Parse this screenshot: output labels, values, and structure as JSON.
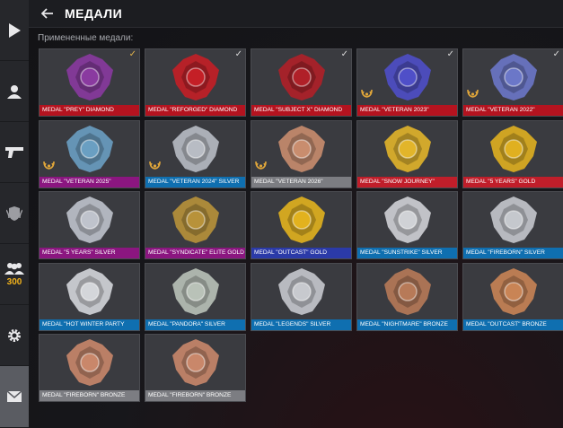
{
  "header": {
    "title": "МЕДАЛИ"
  },
  "subtitle": "Примененные медали:",
  "sidebar": {
    "friends_count": "300"
  },
  "colors": {
    "diamond": "#b4131f",
    "silver_blue": "#0f6fb0",
    "gold": "#c01e2a",
    "purple": "#8b1680",
    "grey": "#7c7d82",
    "gold_blue": "#2b3aa8"
  },
  "medals": [
    {
      "label": "MEDAL \"PREY\" DIAMOND",
      "color": "#b4131f",
      "check": "gold",
      "laurel": false,
      "icon": "prey-medal-icon",
      "art": "#8a3aa0"
    },
    {
      "label": "MEDAL \"REFORGED\" DIAMOND",
      "color": "#b4131f",
      "check": "white",
      "laurel": false,
      "icon": "reforged-medal-icon",
      "art": "#c41f26"
    },
    {
      "label": "MEDAL \"SUBJECT X\" DIAMOND",
      "color": "#b4131f",
      "check": "white",
      "laurel": false,
      "icon": "subject-x-medal-icon",
      "art": "#b02028"
    },
    {
      "label": "MEDAL \"VETERAN 2023\"",
      "color": "#b4131f",
      "check": "white",
      "laurel": true,
      "icon": "veteran-2023-medal-icon",
      "art": "#4f4fc8"
    },
    {
      "label": "MEDAL \"VETERAN 2022\"",
      "color": "#b4131f",
      "check": "white",
      "laurel": true,
      "icon": "veteran-2022-medal-icon",
      "art": "#6b77c8"
    },
    {
      "label": "MEDAL \"VETERAN 2025\"",
      "color": "#8b1680",
      "check": "",
      "laurel": true,
      "icon": "veteran-2025-medal-icon",
      "art": "#6a9fc2"
    },
    {
      "label": "MEDAL \"VETERAN 2024\" SILVER",
      "color": "#0f6fb0",
      "check": "",
      "laurel": true,
      "icon": "veteran-2024-medal-icon",
      "art": "#b8bcc4"
    },
    {
      "label": "MEDAL \"VETERAN 2026\"",
      "color": "#7c7d82",
      "check": "",
      "laurel": true,
      "icon": "veteran-2026-medal-icon",
      "art": "#c98d6e"
    },
    {
      "label": "MEDAL \"SNOW JOURNEY\"",
      "color": "#c01e2a",
      "check": "",
      "laurel": false,
      "icon": "snow-journey-medal-icon",
      "art": "#e2b52a"
    },
    {
      "label": "MEDAL \"5 YEARS\" GOLD",
      "color": "#c01e2a",
      "check": "",
      "laurel": false,
      "icon": "five-years-gold-medal-icon",
      "art": "#e0b020"
    },
    {
      "label": "MEDAL \"5 YEARS\" SILVER",
      "color": "#8b1680",
      "check": "",
      "laurel": false,
      "icon": "five-years-silver-medal-icon",
      "art": "#bfc3cc"
    },
    {
      "label": "MEDAL \"SYNDICATE\" ELITE GOLD",
      "color": "#8b1680",
      "check": "",
      "laurel": false,
      "icon": "syndicate-medal-icon",
      "art": "#b8923a"
    },
    {
      "label": "MEDAL \"OUTCAST\" GOLD",
      "color": "#2b3aa8",
      "check": "",
      "laurel": false,
      "icon": "outcast-gold-medal-icon",
      "art": "#e2b21e"
    },
    {
      "label": "MEDAL \"SUNSTRIKE\" SILVER",
      "color": "#0f6fb0",
      "check": "",
      "laurel": false,
      "icon": "sunstrike-medal-icon",
      "art": "#d0d2d6"
    },
    {
      "label": "MEDAL \"FIREBORN\" SILVER",
      "color": "#0f6fb0",
      "check": "",
      "laurel": false,
      "icon": "fireborn-silver-medal-icon",
      "art": "#c5c8cd"
    },
    {
      "label": "MEDAL \"HOT WINTER PARTY",
      "color": "#0f6fb0",
      "check": "",
      "laurel": false,
      "icon": "hot-winter-party-medal-icon",
      "art": "#d4d6da"
    },
    {
      "label": "MEDAL \"PANDORA\" SILVER",
      "color": "#0f6fb0",
      "check": "",
      "laurel": false,
      "icon": "pandora-medal-icon",
      "art": "#b9c2b8"
    },
    {
      "label": "MEDAL \"LEGENDS\" SILVER",
      "color": "#0f6fb0",
      "check": "",
      "laurel": false,
      "icon": "legends-medal-icon",
      "art": "#c7c9ce"
    },
    {
      "label": "MEDAL \"NIGHTMARE\" BRONZE",
      "color": "#0f6fb0",
      "check": "",
      "laurel": false,
      "icon": "nightmare-medal-icon",
      "art": "#b77a58"
    },
    {
      "label": "MEDAL \"OUTCAST\" BRONZE",
      "color": "#0f6fb0",
      "check": "",
      "laurel": false,
      "icon": "outcast-bronze-medal-icon",
      "art": "#c98455"
    },
    {
      "label": "MEDAL \"FIREBORN\" BRONZE",
      "color": "#7c7d82",
      "check": "",
      "laurel": false,
      "icon": "fireborn-bronze-medal-icon",
      "art": "#c9876a"
    },
    {
      "label": "MEDAL \"FIREBORN\" BRONZE",
      "color": "#7c7d82",
      "check": "",
      "laurel": false,
      "icon": "fireborn-bronze-medal-icon",
      "art": "#c9876a"
    }
  ]
}
